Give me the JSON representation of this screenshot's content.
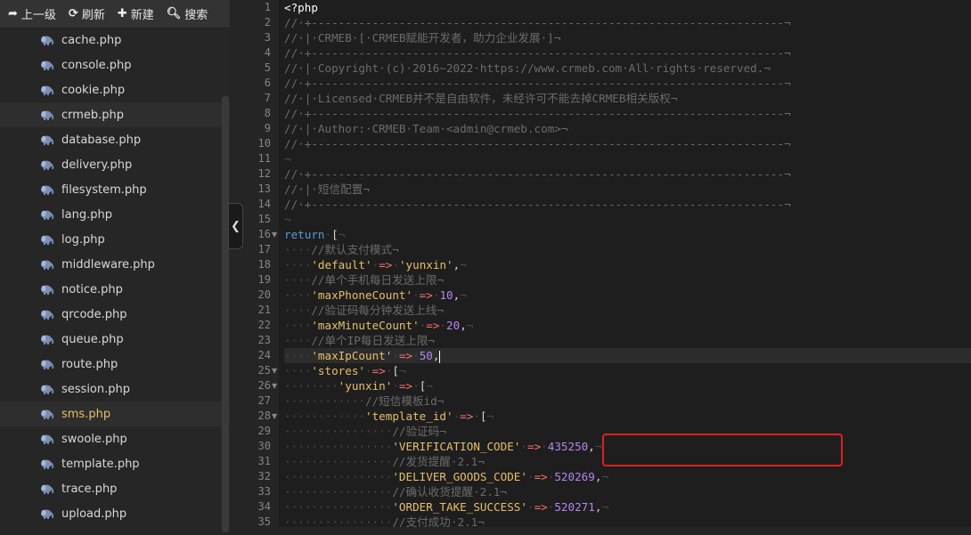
{
  "toolbar": {
    "up_label": "上一级",
    "refresh_label": "刷新",
    "new_label": "新建",
    "search_label": "搜索"
  },
  "files": [
    "cache.php",
    "console.php",
    "cookie.php",
    "crmeb.php",
    "database.php",
    "delivery.php",
    "filesystem.php",
    "lang.php",
    "log.php",
    "middleware.php",
    "notice.php",
    "qrcode.php",
    "queue.php",
    "route.php",
    "session.php",
    "sms.php",
    "swoole.php",
    "template.php",
    "trace.php",
    "upload.php"
  ],
  "active_file": "sms.php",
  "hover_file": "crmeb.php",
  "editor": {
    "current_line": 24,
    "lines": [
      [
        [
          "php",
          "<?php"
        ]
      ],
      [
        [
          "cm",
          "//·+----------------------------------------------------------------------¬"
        ]
      ],
      [
        [
          "cm",
          "//·|·CRMEB·[·CRMEB赋能开发者，助力企业发展·]¬"
        ]
      ],
      [
        [
          "cm",
          "//·+----------------------------------------------------------------------¬"
        ]
      ],
      [
        [
          "cm",
          "//·|·Copyright·(c)·2016~2022·https://www.crmeb.com·All·rights·reserved.¬"
        ]
      ],
      [
        [
          "cm",
          "//·+----------------------------------------------------------------------¬"
        ]
      ],
      [
        [
          "cm",
          "//·|·Licensed·CRMEB并不是自由软件，未经许可不能去掉CRMEB相关版权¬"
        ]
      ],
      [
        [
          "cm",
          "//·+----------------------------------------------------------------------¬"
        ]
      ],
      [
        [
          "cm",
          "//·|·Author:·CRMEB·Team·<admin@crmeb.com>¬"
        ]
      ],
      [
        [
          "cm",
          "//·+----------------------------------------------------------------------¬"
        ]
      ],
      [
        [
          "ws",
          "¬"
        ]
      ],
      [
        [
          "cm",
          "//·+----------------------------------------------------------------------¬"
        ]
      ],
      [
        [
          "cm",
          "//·|·短信配置¬"
        ]
      ],
      [
        [
          "cm",
          "//·+----------------------------------------------------------------------¬"
        ]
      ],
      [
        [
          "ws",
          "¬"
        ]
      ],
      [
        [
          "kw",
          "return"
        ],
        [
          "ws",
          "·"
        ],
        [
          "txt",
          "["
        ],
        [
          "ws",
          "¬"
        ]
      ],
      [
        [
          "ws",
          "····"
        ],
        [
          "cm",
          "//默认支付模式¬"
        ]
      ],
      [
        [
          "ws",
          "····"
        ],
        [
          "str",
          "'default'"
        ],
        [
          "ws",
          "·"
        ],
        [
          "op",
          "=>"
        ],
        [
          "ws",
          "·"
        ],
        [
          "str",
          "'yunxin'"
        ],
        [
          "txt",
          ","
        ],
        [
          "ws",
          "¬"
        ]
      ],
      [
        [
          "ws",
          "····"
        ],
        [
          "cm",
          "//单个手机每日发送上限¬"
        ]
      ],
      [
        [
          "ws",
          "····"
        ],
        [
          "str",
          "'maxPhoneCount'"
        ],
        [
          "ws",
          "·"
        ],
        [
          "op",
          "=>"
        ],
        [
          "ws",
          "·"
        ],
        [
          "num",
          "10"
        ],
        [
          "txt",
          ","
        ],
        [
          "ws",
          "¬"
        ]
      ],
      [
        [
          "ws",
          "····"
        ],
        [
          "cm",
          "//验证码每分钟发送上线¬"
        ]
      ],
      [
        [
          "ws",
          "····"
        ],
        [
          "str",
          "'maxMinuteCount'"
        ],
        [
          "ws",
          "·"
        ],
        [
          "op",
          "=>"
        ],
        [
          "ws",
          "·"
        ],
        [
          "num",
          "20"
        ],
        [
          "txt",
          ","
        ],
        [
          "ws",
          "¬"
        ]
      ],
      [
        [
          "ws",
          "····"
        ],
        [
          "cm",
          "//单个IP每日发送上限¬"
        ]
      ],
      [
        [
          "ws",
          "····"
        ],
        [
          "str",
          "'maxIpCount'"
        ],
        [
          "ws",
          "·"
        ],
        [
          "op",
          "=>"
        ],
        [
          "ws",
          "·"
        ],
        [
          "num",
          "50"
        ],
        [
          "txt",
          ","
        ],
        [
          "caret",
          ""
        ]
      ],
      [
        [
          "ws",
          "····"
        ],
        [
          "str",
          "'stores'"
        ],
        [
          "ws",
          "·"
        ],
        [
          "op",
          "=>"
        ],
        [
          "ws",
          "·"
        ],
        [
          "txt",
          "["
        ],
        [
          "ws",
          "¬"
        ]
      ],
      [
        [
          "ws",
          "········"
        ],
        [
          "str",
          "'yunxin'"
        ],
        [
          "ws",
          "·"
        ],
        [
          "op",
          "=>"
        ],
        [
          "ws",
          "·"
        ],
        [
          "txt",
          "["
        ],
        [
          "ws",
          "¬"
        ]
      ],
      [
        [
          "ws",
          "············"
        ],
        [
          "cm",
          "//短信模板id¬"
        ]
      ],
      [
        [
          "ws",
          "············"
        ],
        [
          "str",
          "'template_id'"
        ],
        [
          "ws",
          "·"
        ],
        [
          "op",
          "=>"
        ],
        [
          "ws",
          "·"
        ],
        [
          "txt",
          "["
        ],
        [
          "ws",
          "¬"
        ]
      ],
      [
        [
          "ws",
          "················"
        ],
        [
          "cm",
          "//验证码¬"
        ]
      ],
      [
        [
          "ws",
          "················"
        ],
        [
          "str",
          "'VERIFICATION_CODE'"
        ],
        [
          "ws",
          "·"
        ],
        [
          "op",
          "=>"
        ],
        [
          "ws",
          "·"
        ],
        [
          "num",
          "435250"
        ],
        [
          "txt",
          ","
        ],
        [
          "ws",
          "¬"
        ]
      ],
      [
        [
          "ws",
          "················"
        ],
        [
          "cm",
          "//发货提醒·2.1¬"
        ]
      ],
      [
        [
          "ws",
          "················"
        ],
        [
          "str",
          "'DELIVER_GOODS_CODE'"
        ],
        [
          "ws",
          "·"
        ],
        [
          "op",
          "=>"
        ],
        [
          "ws",
          "·"
        ],
        [
          "num",
          "520269"
        ],
        [
          "txt",
          ","
        ],
        [
          "ws",
          "¬"
        ]
      ],
      [
        [
          "ws",
          "················"
        ],
        [
          "cm",
          "//确认收货提醒·2.1¬"
        ]
      ],
      [
        [
          "ws",
          "················"
        ],
        [
          "str",
          "'ORDER_TAKE_SUCCESS'"
        ],
        [
          "ws",
          "·"
        ],
        [
          "op",
          "=>"
        ],
        [
          "ws",
          "·"
        ],
        [
          "num",
          "520271"
        ],
        [
          "txt",
          ","
        ],
        [
          "ws",
          "¬"
        ]
      ],
      [
        [
          "ws",
          "················"
        ],
        [
          "cm",
          "//支付成功·2.1¬"
        ]
      ]
    ],
    "fold_lines": [
      16,
      25,
      26,
      28
    ]
  },
  "colors": {
    "sidebar_bg": "#262626",
    "editor_bg": "#1e1e1e",
    "active_file": "#e8bf6a",
    "highlight_box": "#e02020"
  }
}
